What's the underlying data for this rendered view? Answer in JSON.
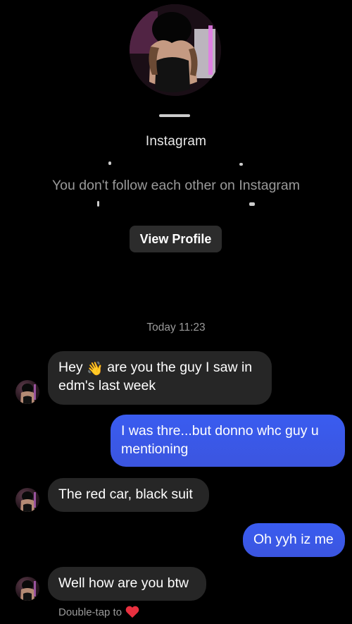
{
  "profile": {
    "app_label": "Instagram",
    "follow_note": "You don't follow each other on Instagram",
    "view_profile_label": "View Profile"
  },
  "thread": {
    "timestamp": "Today 11:23",
    "messages": [
      {
        "sender": "them",
        "text_before": "Hey",
        "emoji": "👋",
        "text_after": "are you the guy I saw in edm's last week"
      },
      {
        "sender": "me",
        "text": "I was thre...but donno whc guy u mentioning"
      },
      {
        "sender": "them",
        "text": "The red car, black suit"
      },
      {
        "sender": "me",
        "text": "Oh yyh iz me"
      },
      {
        "sender": "them",
        "text": "Well how are you btw"
      }
    ],
    "reaction_hint": "Double-tap to",
    "reaction_icon": "heart-icon"
  },
  "colors": {
    "background": "#000000",
    "incoming_bubble": "#262626",
    "outgoing_bubble": "#3b58e8",
    "secondary_text": "#9a9a9a",
    "heart": "#e8303f"
  }
}
